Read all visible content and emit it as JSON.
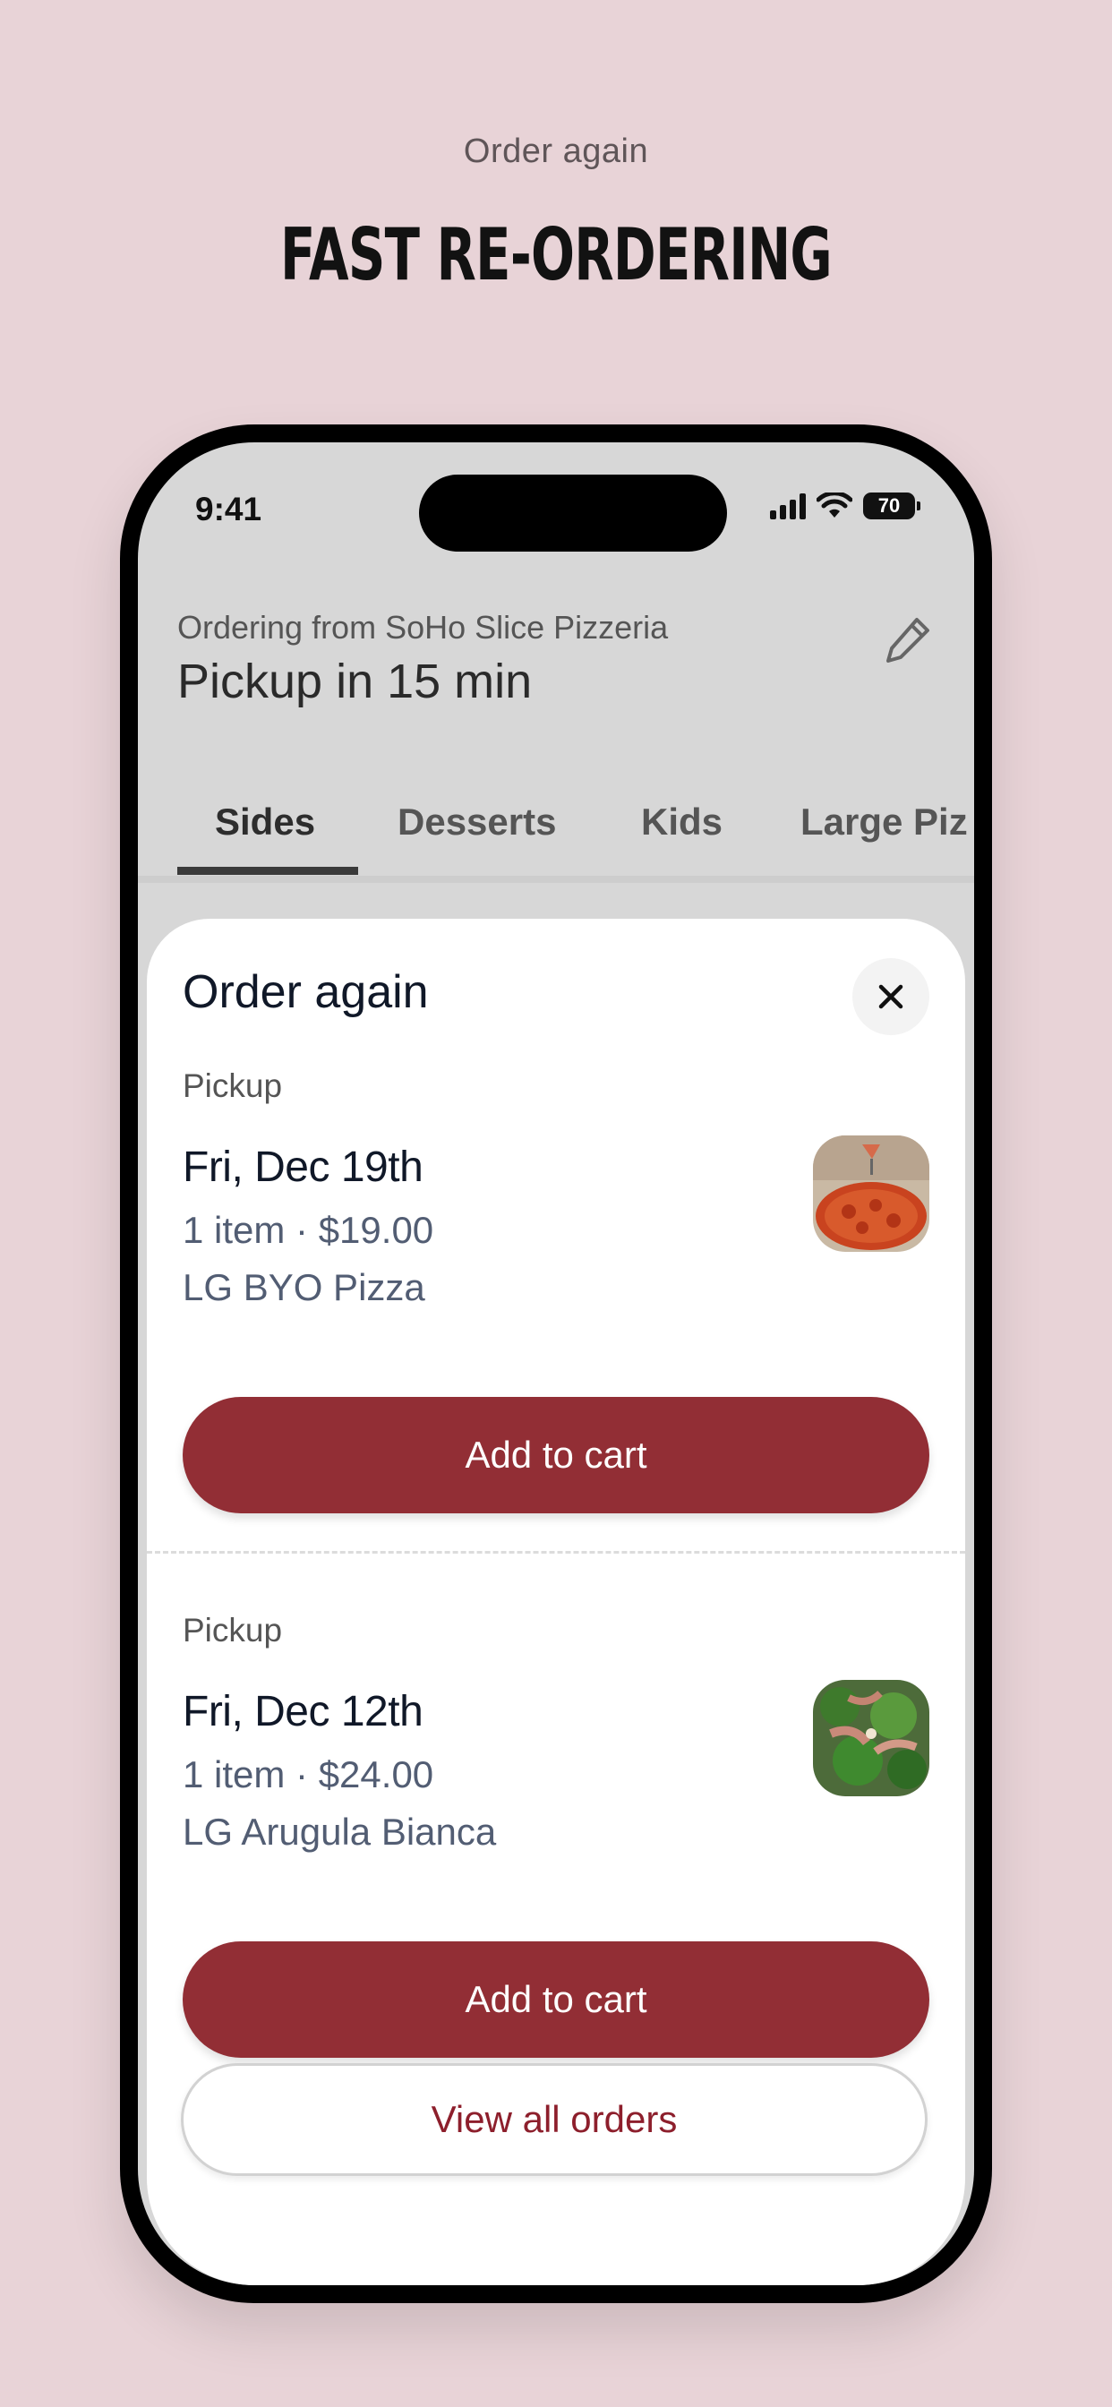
{
  "marketing": {
    "eyebrow": "Order again",
    "title": "FAST RE-ORDERING"
  },
  "status_bar": {
    "time": "9:41",
    "battery": "70"
  },
  "header": {
    "ordering_from": "Ordering from SoHo Slice Pizzeria",
    "pickup_time": "Pickup in 15 min"
  },
  "tabs": [
    {
      "label": "Sides",
      "active": true
    },
    {
      "label": "Desserts",
      "active": false
    },
    {
      "label": "Kids",
      "active": false
    },
    {
      "label": "Large Piz",
      "active": false
    }
  ],
  "sheet": {
    "title": "Order again",
    "orders": [
      {
        "type": "Pickup",
        "date": "Fri, Dec 19th",
        "meta": "1 item · $19.00",
        "item": "LG BYO Pizza",
        "button": "Add to cart"
      },
      {
        "type": "Pickup",
        "date": "Fri, Dec 12th",
        "meta": "1 item · $24.00",
        "item": "LG Arugula Bianca",
        "button": "Add to cart"
      }
    ],
    "view_all": "View all orders"
  },
  "colors": {
    "background": "#e8d3d7",
    "primary_button": "#922e35",
    "link_text": "#8d1f2c"
  }
}
